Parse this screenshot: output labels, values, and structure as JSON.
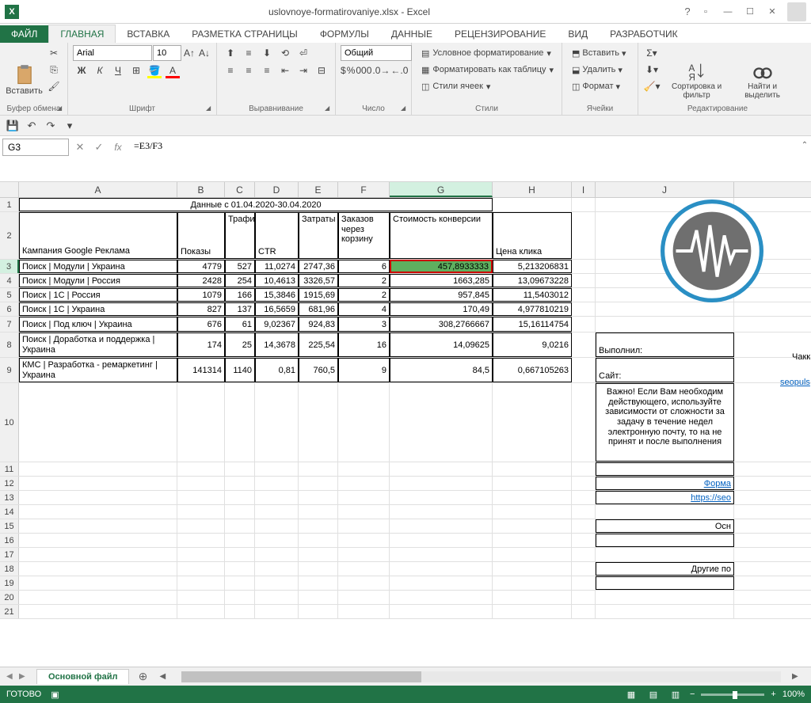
{
  "title": "uslovnoye-formatirovaniye.xlsx - Excel",
  "tabs": {
    "file": "ФАЙЛ",
    "home": "ГЛАВНАЯ",
    "insert": "ВСТАВКА",
    "layout": "РАЗМЕТКА СТРАНИЦЫ",
    "formulas": "ФОРМУЛЫ",
    "data": "ДАННЫЕ",
    "review": "РЕЦЕНЗИРОВАНИЕ",
    "view": "ВИД",
    "developer": "РАЗРАБОТЧИК"
  },
  "ribbon": {
    "paste": "Вставить",
    "clipboard": "Буфер обмена",
    "font_name": "Arial",
    "font_size": "10",
    "font_group": "Шрифт",
    "align_group": "Выравнивание",
    "number_format": "Общий",
    "number_group": "Число",
    "cond_fmt": "Условное форматирование",
    "as_table": "Форматировать как таблицу",
    "cell_styles": "Стили ячеек",
    "styles_group": "Стили",
    "insert_cells": "Вставить",
    "delete_cells": "Удалить",
    "format_cells": "Формат",
    "cells_group": "Ячейки",
    "sort": "Сортировка и фильтр",
    "find": "Найти и выделить",
    "editing_group": "Редактирование"
  },
  "name_box": "G3",
  "formula": "=E3/F3",
  "col_labels": [
    "A",
    "B",
    "C",
    "D",
    "E",
    "F",
    "G",
    "H",
    "I",
    "J"
  ],
  "headers": {
    "title": "Данные с 01.04.2020-30.04.2020",
    "campaign": "Кампания Google Реклама",
    "impressions": "Показы",
    "traffic": "Трафик",
    "ctr": "CTR",
    "costs": "Затраты",
    "orders": "Заказов через корзину",
    "conv_cost": "Стоимость конверсии",
    "click_cost": "Цена клика"
  },
  "rows": [
    {
      "a": "Поиск | Модули | Украина",
      "b": "4779",
      "c": "527",
      "d": "11,0274",
      "e": "2747,36",
      "f": "6",
      "g": "457,8933333",
      "h": "5,213206831"
    },
    {
      "a": "Поиск | Модули | Россия",
      "b": "2428",
      "c": "254",
      "d": "10,4613",
      "e": "3326,57",
      "f": "2",
      "g": "1663,285",
      "h": "13,09673228"
    },
    {
      "a": "Поиск | 1С | Россия",
      "b": "1079",
      "c": "166",
      "d": "15,3846",
      "e": "1915,69",
      "f": "2",
      "g": "957,845",
      "h": "11,5403012"
    },
    {
      "a": "Поиск | 1С | Украина",
      "b": "827",
      "c": "137",
      "d": "16,5659",
      "e": "681,96",
      "f": "4",
      "g": "170,49",
      "h": "4,977810219"
    },
    {
      "a": "Поиск | Под ключ | Украина",
      "b": "676",
      "c": "61",
      "d": "9,02367",
      "e": "924,83",
      "f": "3",
      "g": "308,2766667",
      "h": "15,16114754"
    },
    {
      "a": "Поиск | Доработка и поддержка | Украина",
      "b": "174",
      "c": "25",
      "d": "14,3678",
      "e": "225,54",
      "f": "16",
      "g": "14,09625",
      "h": "9,0216"
    },
    {
      "a": "КМС | Разработка - ремаркетинг | Украина",
      "b": "141314",
      "c": "1140",
      "d": "0,81",
      "e": "760,5",
      "f": "9",
      "g": "84,5",
      "h": "0,667105263"
    }
  ],
  "side": {
    "performed": "Выполнил:",
    "performed_val": "Чакканб",
    "site": "Сайт:",
    "site_val": "seopuls",
    "note": "Важно! Если Вам необходим действующего, используйте зависимости от сложности за задачу в течение недел электронную почту, то на не принят и после выполнения",
    "form": "Форма",
    "url": "https://seo",
    "osn": "Осн",
    "other": "Другие по"
  },
  "sheet": {
    "name": "Основной файл"
  },
  "status": {
    "ready": "ГОТОВО",
    "zoom": "100%"
  }
}
